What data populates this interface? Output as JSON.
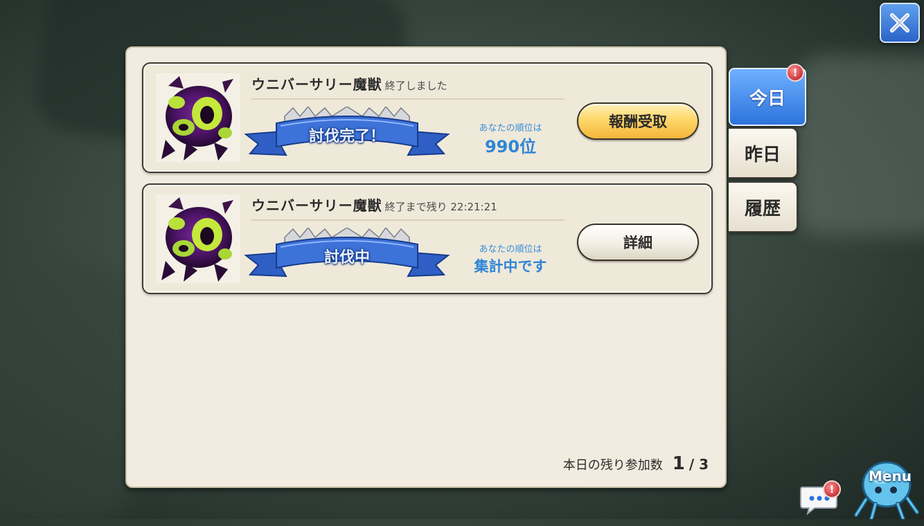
{
  "close": {
    "icon": "close-icon"
  },
  "cards": [
    {
      "title": "ウニバーサリー魔獣",
      "status": "終了しました",
      "banner": "討伐完了！",
      "rank_label": "あなたの順位は",
      "rank_value": "990位",
      "button": "報酬受取",
      "button_style": "gold"
    },
    {
      "title": "ウニバーサリー魔獣",
      "status": "終了まで残り 22:21:21",
      "banner": "討伐中",
      "rank_label": "あなたの順位は",
      "rank_value": "集計中です",
      "button": "詳細",
      "button_style": "plain"
    }
  ],
  "remaining": {
    "label": "本日の残り参加数",
    "count": "1",
    "total": "/ 3"
  },
  "tabs": [
    {
      "label": "今日",
      "active": true,
      "badge": "!"
    },
    {
      "label": "昨日",
      "active": false
    },
    {
      "label": "履歴",
      "active": false
    }
  ],
  "footer": {
    "chat_badge": "!",
    "menu_label": "Menu"
  },
  "colors": {
    "accent_blue": "#2c74dc",
    "rank_blue": "#2f86d6",
    "gold_button": "#f4b43a",
    "panel_bg": "#f1ecdf"
  }
}
